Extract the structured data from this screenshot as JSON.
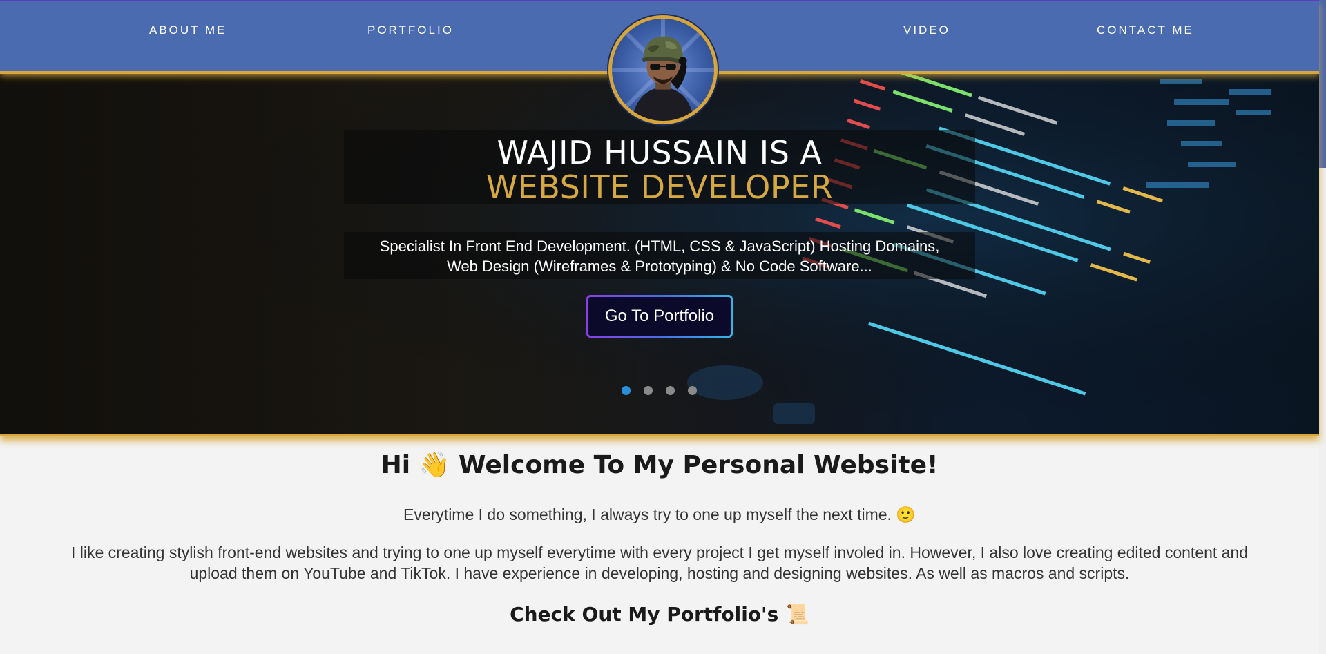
{
  "navbar": {
    "about_label": "ABOUT ME",
    "portfolio_label": "PORTFOLIO",
    "video_label": "VIDEO",
    "contact_label": "CONTACT ME",
    "avatar_icon": "avatar-character-icon"
  },
  "hero": {
    "title_line_1": "WAJID HUSSAIN IS A",
    "title_line_2": "WEBSITE DEVELOPER",
    "subtitle_line_1": "Specialist In Front End Development. (HTML, CSS & JavaScript) Hosting Domains,",
    "subtitle_line_2": "Web Design (Wireframes & Prototyping) & No Code Software...",
    "button_label": "Go To Portfolio",
    "slide_count": 4,
    "active_slide": 1,
    "colors": {
      "accent_gold": "#d6a842",
      "nav_blue": "#4a6bb0",
      "dot_active": "#2a8fd8"
    }
  },
  "content": {
    "welcome_text": "Hi 👋 Welcome To My Personal Website!",
    "tagline": "Everytime I do something, I always try to one up myself the next time. 🙂",
    "about_line_1": "I like creating stylish front-end websites and trying to one up myself everytime with every project I get myself involed in. However, I also love creating edited content and",
    "about_line_2": "upload them on YouTube and TikTok. I have experience in developing, hosting and designing websites. As well as macros and scripts.",
    "portfolio_heading": "Check Out My Portfolio's 📜"
  }
}
